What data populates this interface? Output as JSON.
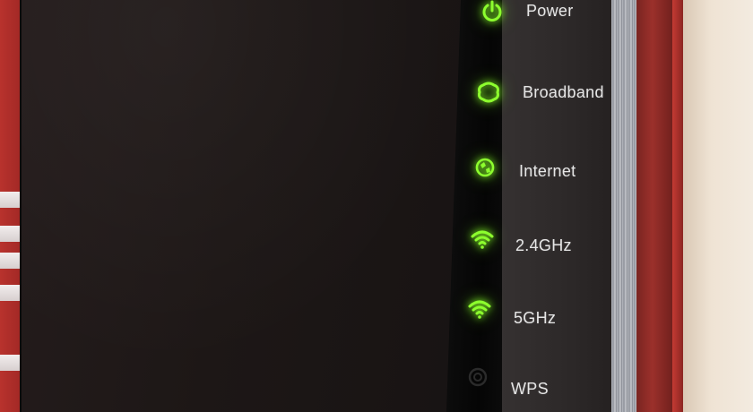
{
  "device": {
    "indicators": [
      {
        "id": "power",
        "label": "Power",
        "icon": "power-icon",
        "state": "on"
      },
      {
        "id": "broadband",
        "label": "Broadband",
        "icon": "broadband-icon",
        "state": "on"
      },
      {
        "id": "internet",
        "label": "Internet",
        "icon": "internet-icon",
        "state": "on"
      },
      {
        "id": "wifi24",
        "label": "2.4GHz",
        "icon": "wifi-icon",
        "state": "on"
      },
      {
        "id": "wifi5",
        "label": "5GHz",
        "icon": "wifi-icon",
        "state": "on"
      },
      {
        "id": "wps",
        "label": "WPS",
        "icon": "wps-icon",
        "state": "off"
      }
    ],
    "colors": {
      "led_on": "#8dff2e",
      "led_off": "#3a3a3a",
      "label_text": "#e6e6e6"
    }
  }
}
